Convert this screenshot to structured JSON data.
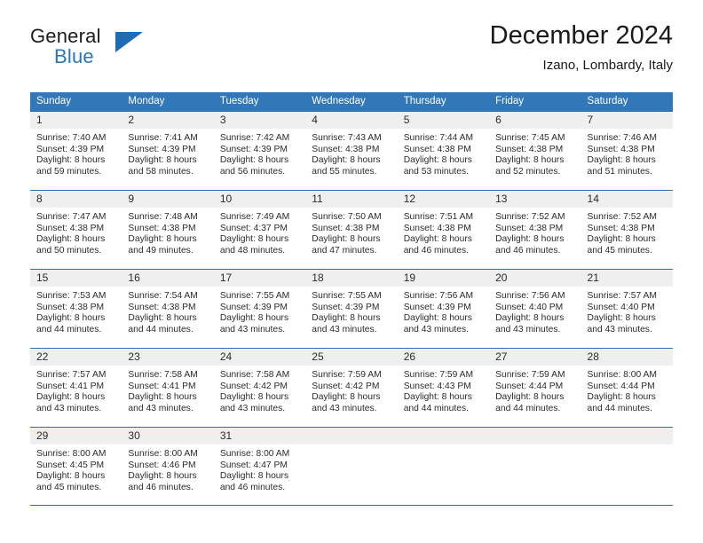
{
  "brand": {
    "name_part1": "General",
    "name_part2": "Blue",
    "triangle_color": "#1f6cb5",
    "blue_text_color": "#2576bd"
  },
  "header": {
    "title": "December 2024",
    "subtitle": "Izano, Lombardy, Italy"
  },
  "theme": {
    "header_row_background": "#3277b7",
    "header_row_text": "#ffffff",
    "week_separator": "#2f6fae",
    "day_band_background": "#efefef",
    "body_text": "#2b2b2b"
  },
  "weekdays": [
    "Sunday",
    "Monday",
    "Tuesday",
    "Wednesday",
    "Thursday",
    "Friday",
    "Saturday"
  ],
  "weeks": [
    [
      {
        "day": "1",
        "sunrise": "Sunrise: 7:40 AM",
        "sunset": "Sunset: 4:39 PM",
        "daylight1": "Daylight: 8 hours",
        "daylight2": "and 59 minutes."
      },
      {
        "day": "2",
        "sunrise": "Sunrise: 7:41 AM",
        "sunset": "Sunset: 4:39 PM",
        "daylight1": "Daylight: 8 hours",
        "daylight2": "and 58 minutes."
      },
      {
        "day": "3",
        "sunrise": "Sunrise: 7:42 AM",
        "sunset": "Sunset: 4:39 PM",
        "daylight1": "Daylight: 8 hours",
        "daylight2": "and 56 minutes."
      },
      {
        "day": "4",
        "sunrise": "Sunrise: 7:43 AM",
        "sunset": "Sunset: 4:38 PM",
        "daylight1": "Daylight: 8 hours",
        "daylight2": "and 55 minutes."
      },
      {
        "day": "5",
        "sunrise": "Sunrise: 7:44 AM",
        "sunset": "Sunset: 4:38 PM",
        "daylight1": "Daylight: 8 hours",
        "daylight2": "and 53 minutes."
      },
      {
        "day": "6",
        "sunrise": "Sunrise: 7:45 AM",
        "sunset": "Sunset: 4:38 PM",
        "daylight1": "Daylight: 8 hours",
        "daylight2": "and 52 minutes."
      },
      {
        "day": "7",
        "sunrise": "Sunrise: 7:46 AM",
        "sunset": "Sunset: 4:38 PM",
        "daylight1": "Daylight: 8 hours",
        "daylight2": "and 51 minutes."
      }
    ],
    [
      {
        "day": "8",
        "sunrise": "Sunrise: 7:47 AM",
        "sunset": "Sunset: 4:38 PM",
        "daylight1": "Daylight: 8 hours",
        "daylight2": "and 50 minutes."
      },
      {
        "day": "9",
        "sunrise": "Sunrise: 7:48 AM",
        "sunset": "Sunset: 4:38 PM",
        "daylight1": "Daylight: 8 hours",
        "daylight2": "and 49 minutes."
      },
      {
        "day": "10",
        "sunrise": "Sunrise: 7:49 AM",
        "sunset": "Sunset: 4:37 PM",
        "daylight1": "Daylight: 8 hours",
        "daylight2": "and 48 minutes."
      },
      {
        "day": "11",
        "sunrise": "Sunrise: 7:50 AM",
        "sunset": "Sunset: 4:38 PM",
        "daylight1": "Daylight: 8 hours",
        "daylight2": "and 47 minutes."
      },
      {
        "day": "12",
        "sunrise": "Sunrise: 7:51 AM",
        "sunset": "Sunset: 4:38 PM",
        "daylight1": "Daylight: 8 hours",
        "daylight2": "and 46 minutes."
      },
      {
        "day": "13",
        "sunrise": "Sunrise: 7:52 AM",
        "sunset": "Sunset: 4:38 PM",
        "daylight1": "Daylight: 8 hours",
        "daylight2": "and 46 minutes."
      },
      {
        "day": "14",
        "sunrise": "Sunrise: 7:52 AM",
        "sunset": "Sunset: 4:38 PM",
        "daylight1": "Daylight: 8 hours",
        "daylight2": "and 45 minutes."
      }
    ],
    [
      {
        "day": "15",
        "sunrise": "Sunrise: 7:53 AM",
        "sunset": "Sunset: 4:38 PM",
        "daylight1": "Daylight: 8 hours",
        "daylight2": "and 44 minutes."
      },
      {
        "day": "16",
        "sunrise": "Sunrise: 7:54 AM",
        "sunset": "Sunset: 4:38 PM",
        "daylight1": "Daylight: 8 hours",
        "daylight2": "and 44 minutes."
      },
      {
        "day": "17",
        "sunrise": "Sunrise: 7:55 AM",
        "sunset": "Sunset: 4:39 PM",
        "daylight1": "Daylight: 8 hours",
        "daylight2": "and 43 minutes."
      },
      {
        "day": "18",
        "sunrise": "Sunrise: 7:55 AM",
        "sunset": "Sunset: 4:39 PM",
        "daylight1": "Daylight: 8 hours",
        "daylight2": "and 43 minutes."
      },
      {
        "day": "19",
        "sunrise": "Sunrise: 7:56 AM",
        "sunset": "Sunset: 4:39 PM",
        "daylight1": "Daylight: 8 hours",
        "daylight2": "and 43 minutes."
      },
      {
        "day": "20",
        "sunrise": "Sunrise: 7:56 AM",
        "sunset": "Sunset: 4:40 PM",
        "daylight1": "Daylight: 8 hours",
        "daylight2": "and 43 minutes."
      },
      {
        "day": "21",
        "sunrise": "Sunrise: 7:57 AM",
        "sunset": "Sunset: 4:40 PM",
        "daylight1": "Daylight: 8 hours",
        "daylight2": "and 43 minutes."
      }
    ],
    [
      {
        "day": "22",
        "sunrise": "Sunrise: 7:57 AM",
        "sunset": "Sunset: 4:41 PM",
        "daylight1": "Daylight: 8 hours",
        "daylight2": "and 43 minutes."
      },
      {
        "day": "23",
        "sunrise": "Sunrise: 7:58 AM",
        "sunset": "Sunset: 4:41 PM",
        "daylight1": "Daylight: 8 hours",
        "daylight2": "and 43 minutes."
      },
      {
        "day": "24",
        "sunrise": "Sunrise: 7:58 AM",
        "sunset": "Sunset: 4:42 PM",
        "daylight1": "Daylight: 8 hours",
        "daylight2": "and 43 minutes."
      },
      {
        "day": "25",
        "sunrise": "Sunrise: 7:59 AM",
        "sunset": "Sunset: 4:42 PM",
        "daylight1": "Daylight: 8 hours",
        "daylight2": "and 43 minutes."
      },
      {
        "day": "26",
        "sunrise": "Sunrise: 7:59 AM",
        "sunset": "Sunset: 4:43 PM",
        "daylight1": "Daylight: 8 hours",
        "daylight2": "and 44 minutes."
      },
      {
        "day": "27",
        "sunrise": "Sunrise: 7:59 AM",
        "sunset": "Sunset: 4:44 PM",
        "daylight1": "Daylight: 8 hours",
        "daylight2": "and 44 minutes."
      },
      {
        "day": "28",
        "sunrise": "Sunrise: 8:00 AM",
        "sunset": "Sunset: 4:44 PM",
        "daylight1": "Daylight: 8 hours",
        "daylight2": "and 44 minutes."
      }
    ],
    [
      {
        "day": "29",
        "sunrise": "Sunrise: 8:00 AM",
        "sunset": "Sunset: 4:45 PM",
        "daylight1": "Daylight: 8 hours",
        "daylight2": "and 45 minutes."
      },
      {
        "day": "30",
        "sunrise": "Sunrise: 8:00 AM",
        "sunset": "Sunset: 4:46 PM",
        "daylight1": "Daylight: 8 hours",
        "daylight2": "and 46 minutes."
      },
      {
        "day": "31",
        "sunrise": "Sunrise: 8:00 AM",
        "sunset": "Sunset: 4:47 PM",
        "daylight1": "Daylight: 8 hours",
        "daylight2": "and 46 minutes."
      },
      {
        "day": "",
        "sunrise": "",
        "sunset": "",
        "daylight1": "",
        "daylight2": ""
      },
      {
        "day": "",
        "sunrise": "",
        "sunset": "",
        "daylight1": "",
        "daylight2": ""
      },
      {
        "day": "",
        "sunrise": "",
        "sunset": "",
        "daylight1": "",
        "daylight2": ""
      },
      {
        "day": "",
        "sunrise": "",
        "sunset": "",
        "daylight1": "",
        "daylight2": ""
      }
    ]
  ]
}
